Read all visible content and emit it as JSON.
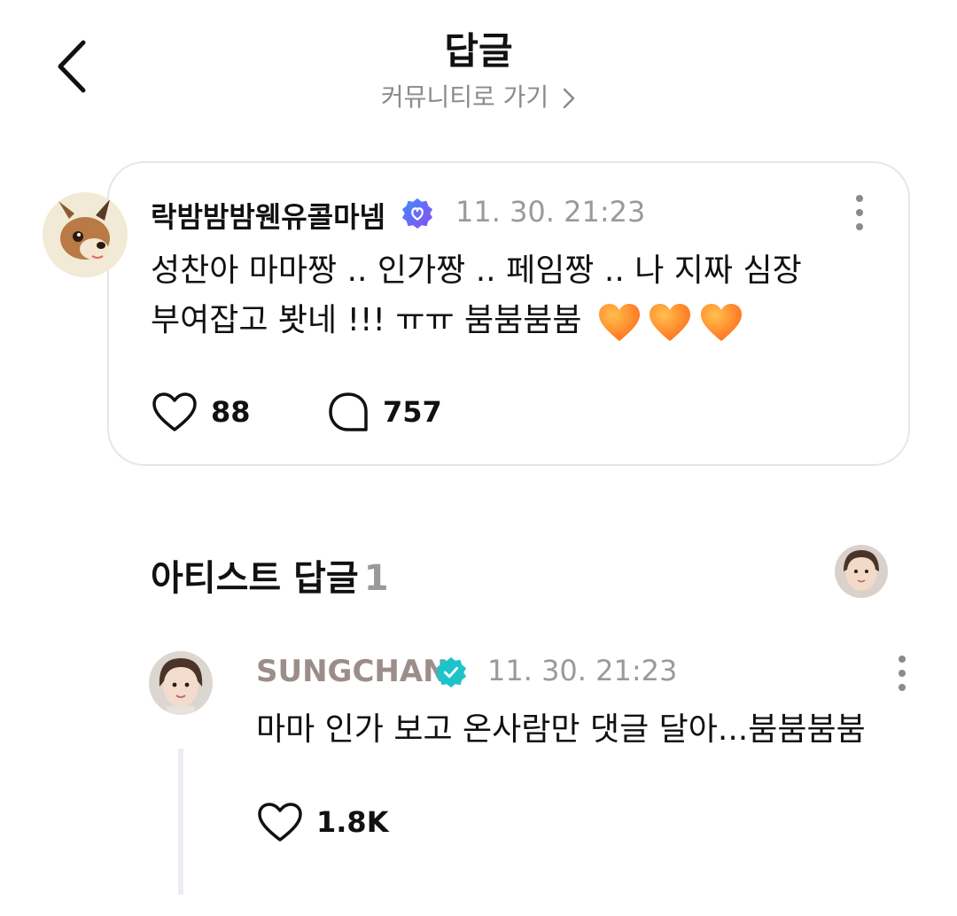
{
  "header": {
    "title": "답글",
    "community_link": "커뮤니티로 가기"
  },
  "post": {
    "author": "락밤밤밤웬유콜마넴",
    "time": "11. 30. 21:23",
    "body_line1": "성찬아 마마짱 .. 인가짱 .. 페임짱 .. 나 지짜 심장",
    "body_line2": "부여잡고 봣네 !!! ㅠㅠ 붐붐붐붐",
    "body_emoji": "🧡🧡🧡",
    "likes": "88",
    "replies": "757"
  },
  "artist_section": {
    "heading": "아티스트 답글",
    "count": "1"
  },
  "reply": {
    "author": "SUNGCHAN",
    "time": "11. 30. 21:23",
    "body": "마마 인가 보고 온사람만 댓글 달아...붐붐붐붐",
    "likes": "1.8K"
  },
  "colors": {
    "verified_post": "#6a5cf0",
    "verified_artist": "#1ec3c9",
    "artist_name": "#9c8d8b",
    "muted": "#9a9a9a",
    "heart_orange": "#ff8a1f"
  },
  "icons": [
    "back-arrow-icon",
    "chevron-right-icon",
    "verified-badge-icon",
    "more-vertical-icon",
    "heart-outline-icon",
    "speech-bubble-icon",
    "heart-emoji"
  ]
}
